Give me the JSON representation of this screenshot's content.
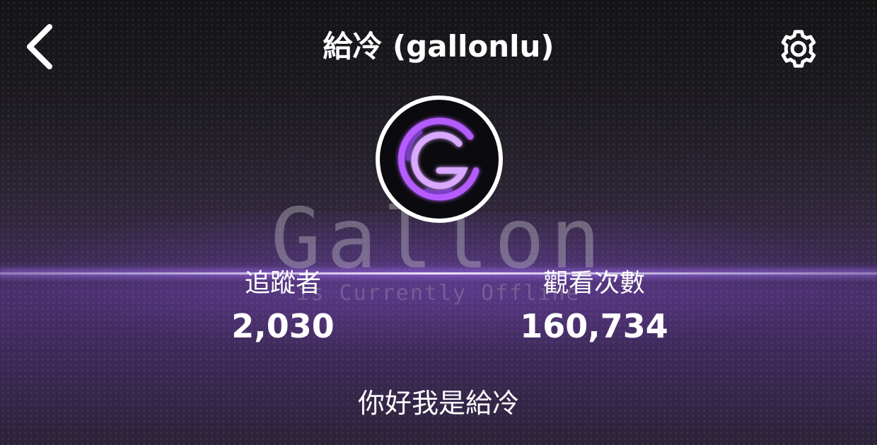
{
  "header": {
    "title": "給冷 (gallonlu)",
    "back_icon": "chevron-left-icon",
    "settings_icon": "gear-icon"
  },
  "banner": {
    "text": "Gallon",
    "subtext": "is Currently Offline"
  },
  "avatar": {
    "letter": "G",
    "accent_color": "#b55cff"
  },
  "stats": {
    "followers_label": "追蹤者",
    "followers_value": "2,030",
    "views_label": "觀看次數",
    "views_value": "160,734"
  },
  "bio": "你好我是給冷",
  "colors": {
    "text": "#ffffff",
    "glow": "#c9a8ff",
    "background_purple": "#4a2f6e"
  }
}
